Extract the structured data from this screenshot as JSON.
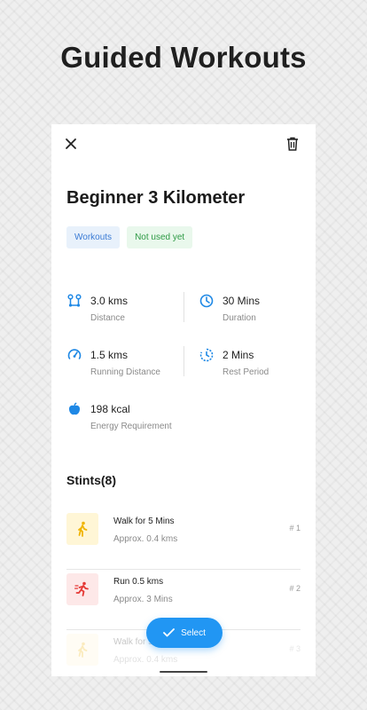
{
  "promo": {
    "title": "Guided Workouts"
  },
  "workout": {
    "title": "Beginner 3 Kilometer",
    "tags": [
      "Workouts",
      "Not used yet"
    ]
  },
  "stats": [
    {
      "value": "3.0 kms",
      "label": "Distance",
      "icon": "route-icon"
    },
    {
      "value": "30 Mins",
      "label": "Duration",
      "icon": "clock-icon"
    },
    {
      "value": "1.5 kms",
      "label": "Running Distance",
      "icon": "speedometer-icon"
    },
    {
      "value": "2 Mins",
      "label": "Rest Period",
      "icon": "timer-icon"
    },
    {
      "value": "198 kcal",
      "label": "Energy Requirement",
      "icon": "apple-icon"
    }
  ],
  "stints": {
    "title": "Stints(8)",
    "items": [
      {
        "name": "Walk for 5 Mins",
        "sub": "Approx. 0.4 kms",
        "num": "# 1",
        "icon": "walk-icon"
      },
      {
        "name": "Run 0.5 kms",
        "sub": "Approx. 3 Mins",
        "num": "# 2",
        "icon": "run-icon"
      },
      {
        "name": "Walk for 5 Mins",
        "sub": "Approx. 0.4 kms",
        "num": "# 3",
        "icon": "walk-icon"
      }
    ]
  },
  "actions": {
    "select_label": "Select"
  },
  "colors": {
    "accent": "#2196f3",
    "walk_bg": "#fff6d6",
    "walk_fg": "#f0b400",
    "run_bg": "#fde8e8",
    "run_fg": "#e53935"
  }
}
